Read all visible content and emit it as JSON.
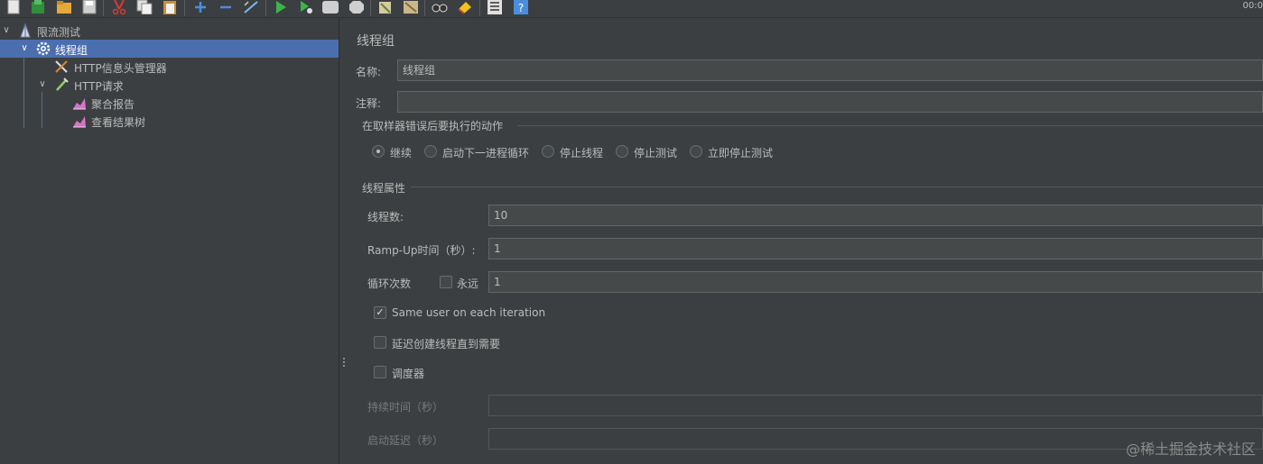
{
  "toolbar": {
    "icons": [
      "new-icon",
      "templates-icon",
      "open-icon",
      "save-icon",
      "cut-icon",
      "copy-icon",
      "paste-icon",
      "expand-icon",
      "collapse-icon",
      "toggle-icon",
      "start-icon",
      "start-no-pause-icon",
      "stop-icon",
      "shutdown-icon",
      "clear-icon",
      "clear-all-icon",
      "search-icon",
      "reset-search-icon",
      "function-helper-icon",
      "help-icon"
    ],
    "time": "00:0"
  },
  "tree": {
    "items": [
      {
        "label": "限流测试",
        "icon": "test-plan-icon"
      },
      {
        "label": "线程组",
        "icon": "gear-icon"
      },
      {
        "label": "HTTP信息头管理器",
        "icon": "wrench-icon"
      },
      {
        "label": "HTTP请求",
        "icon": "pipette-icon"
      },
      {
        "label": "聚合报告",
        "icon": "chart-icon"
      },
      {
        "label": "查看结果树",
        "icon": "chart-icon"
      }
    ]
  },
  "panel": {
    "title": "线程组",
    "name_label": "名称:",
    "name_value": "线程组",
    "comment_label": "注释:",
    "comment_value": "",
    "sampler_error": {
      "legend": "在取样器错误后要执行的动作",
      "options": [
        "继续",
        "启动下一进程循环",
        "停止线程",
        "停止测试",
        "立即停止测试"
      ],
      "selected": "继续"
    },
    "thread_props": {
      "legend": "线程属性",
      "threads_label": "线程数:",
      "threads_value": "10",
      "rampup_label": "Ramp-Up时间（秒）:",
      "rampup_value": "1",
      "loop_label": "循环次数",
      "forever_label": "永远",
      "forever_checked": false,
      "loop_value": "1",
      "same_user_label": "Same user on each iteration",
      "same_user_checked": true,
      "delay_create_label": "延迟创建线程直到需要",
      "delay_create_checked": false,
      "scheduler_label": "调度器",
      "scheduler_checked": false,
      "duration_label": "持续时间（秒）",
      "duration_value": "",
      "startup_delay_label": "启动延迟（秒）",
      "startup_delay_value": ""
    }
  },
  "watermark": "@稀土掘金技术社区"
}
